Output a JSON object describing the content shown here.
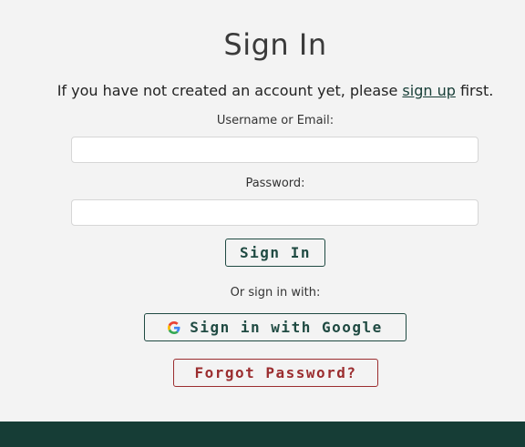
{
  "page": {
    "title": "Sign In",
    "intro_prefix": "If you have not created an account yet, please ",
    "intro_link": "sign up",
    "intro_suffix": " first."
  },
  "form": {
    "username_label": "Username or Email:",
    "username_value": "",
    "password_label": "Password:",
    "password_value": "",
    "submit_label": "Sign In"
  },
  "social": {
    "prompt": "Or sign in with:",
    "google_label": "Sign in with Google",
    "google_icon": "google-g-icon"
  },
  "forgot_label": "Forgot Password?",
  "colors": {
    "background": "#f3f3f3",
    "accent": "#1f4a42",
    "footer": "#163d36",
    "danger": "#9b2d2f"
  }
}
